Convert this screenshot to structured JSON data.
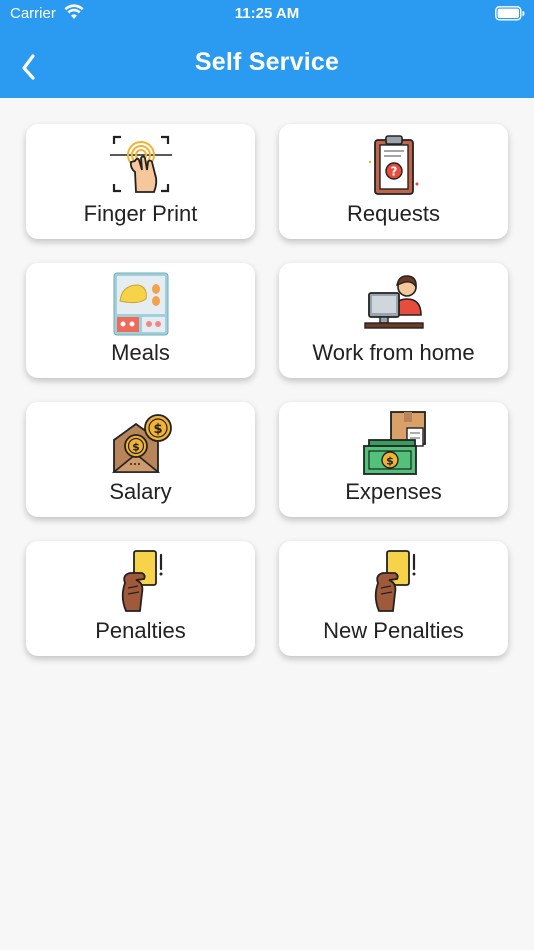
{
  "status_bar": {
    "carrier": "Carrier",
    "time": "11:25 AM"
  },
  "header": {
    "title": "Self Service",
    "back_icon": "chevron-left-icon",
    "color": "#2a9bf0"
  },
  "services": [
    {
      "label": "Finger Print",
      "icon": "fingerprint-icon"
    },
    {
      "label": "Requests",
      "icon": "clipboard-question-icon"
    },
    {
      "label": "Meals",
      "icon": "lunchbox-icon"
    },
    {
      "label": "Work from home",
      "icon": "person-at-computer-icon"
    },
    {
      "label": "Salary",
      "icon": "envelope-coins-icon"
    },
    {
      "label": "Expenses",
      "icon": "money-box-icon"
    },
    {
      "label": "Penalties",
      "icon": "yellow-card-icon"
    },
    {
      "label": "New Penalties",
      "icon": "yellow-card-icon"
    }
  ]
}
